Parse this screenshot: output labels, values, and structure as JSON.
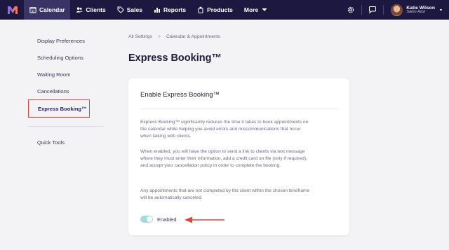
{
  "nav": {
    "items": [
      {
        "label": "Calendar",
        "icon": "calendar-icon"
      },
      {
        "label": "Clients",
        "icon": "clients-icon"
      },
      {
        "label": "Sales",
        "icon": "tag-icon"
      },
      {
        "label": "Reports",
        "icon": "reports-icon"
      },
      {
        "label": "Products",
        "icon": "products-icon"
      },
      {
        "label": "More",
        "icon": "caret-down-icon"
      }
    ],
    "user": {
      "name": "Katie Wilson",
      "subtitle": "Salon Azul"
    }
  },
  "sidebar": {
    "items": [
      {
        "label": "Display Preferences"
      },
      {
        "label": "Scheduling Options"
      },
      {
        "label": "Waiting Room"
      },
      {
        "label": "Cancellations"
      },
      {
        "label": "Express Booking™"
      }
    ],
    "quick_tools": "Quick Tools"
  },
  "breadcrumb": {
    "root": "All Settings",
    "separator": ">",
    "current": "Calendar & Appointments"
  },
  "page_title": "Express Booking™",
  "card": {
    "title": "Enable Express Booking™",
    "p1": "Express Booking™ significantly reduces the time it takes to book appointments on the calendar while helping you avoid errors and miscommunications that occur when talking with clients.",
    "p2": "When enabled, you will have the option to send a link to clients via text message where they must enter their information, add a credit card on file (only if required), and accept your cancellation policy in order to complete the booking.",
    "p3": "Any appointments that are not completed by the client within the chosen timeframe will be automatically canceled.",
    "toggle_label": "Enabled",
    "toggle_on": true
  },
  "colors": {
    "nav_bg": "#1c1840",
    "accent": "#e0453a",
    "toggle": "#9fdcd9"
  }
}
